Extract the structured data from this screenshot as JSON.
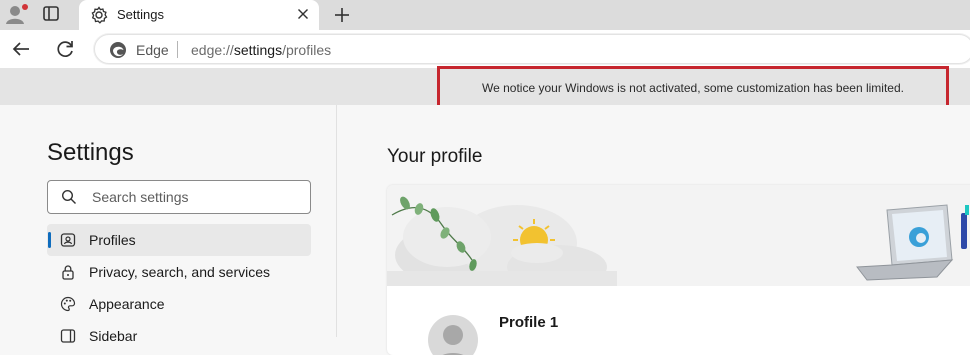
{
  "tab": {
    "title": "Settings"
  },
  "omnibox": {
    "brand": "Edge",
    "url_scheme": "edge://",
    "url_host": "settings",
    "url_path": "/profiles"
  },
  "notice": {
    "text": "We notice your Windows is not activated, some customization has been limited.",
    "border_color": "#c6262e"
  },
  "sidebar": {
    "title": "Settings",
    "search_placeholder": "Search settings",
    "items": [
      {
        "label": "Profiles",
        "icon": "profile-card-icon",
        "active": true
      },
      {
        "label": "Privacy, search, and services",
        "icon": "lock-icon",
        "active": false
      },
      {
        "label": "Appearance",
        "icon": "palette-icon",
        "active": false
      },
      {
        "label": "Sidebar",
        "icon": "sidebar-icon",
        "active": false
      }
    ]
  },
  "main": {
    "section_title": "Your profile",
    "profile_name": "Profile 1"
  },
  "colors": {
    "accent": "#0f6cbd",
    "tab_strip": "#dcdcdc",
    "infobar": "#e4e4e4"
  }
}
